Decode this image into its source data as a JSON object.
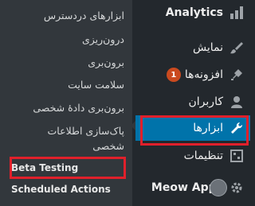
{
  "menu": {
    "items": [
      {
        "label": "Analytics",
        "icon": "bar-chart-icon"
      },
      {
        "label": "نمایش",
        "icon": "paint-brush-icon"
      },
      {
        "label": "افزونه‌ها",
        "icon": "plug-icon",
        "badge": "1"
      },
      {
        "label": "کاربران",
        "icon": "user-icon"
      },
      {
        "label": "ابزارها",
        "icon": "wrench-icon",
        "current": true
      },
      {
        "label": "تنظیمات",
        "icon": "settings-icon"
      },
      {
        "label": "Meow Apps",
        "icon": "gear-icon"
      }
    ]
  },
  "submenu": {
    "items": [
      {
        "label": "ابزارهای دردسترس"
      },
      {
        "label": "درون‌ریزی"
      },
      {
        "label": "برون‌بری"
      },
      {
        "label": "سلامت سایت"
      },
      {
        "label": "برون‌بری دادهٔ شخصی"
      },
      {
        "label": "پاک‌سازی اطلاعات شخصی"
      },
      {
        "label": "Beta Testing"
      },
      {
        "label": "Scheduled Actions"
      }
    ]
  },
  "colors": {
    "menu_bg": "#23282d",
    "submenu_bg": "#32373c",
    "current_bg": "#0073aa",
    "badge_bg": "#ca4a1f",
    "highlight": "#e0202b"
  }
}
